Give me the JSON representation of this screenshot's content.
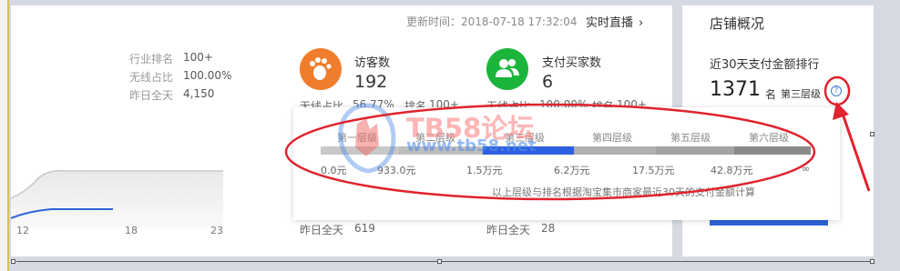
{
  "header": {
    "update_time": "更新时间：2018-07-18 17:32:04",
    "live_link": "实时直播",
    "live_chevron": "›"
  },
  "left_stats": [
    {
      "label": "行业排名",
      "value": "100+"
    },
    {
      "label": "无线占比",
      "value": "100.00%"
    },
    {
      "label": "昨日全天",
      "value": "4,150"
    }
  ],
  "visitors": {
    "title": "访客数",
    "value": "192",
    "wireless_label": "无线占比",
    "wireless_value": "56.77%",
    "rank_label": "排名",
    "rank_value": "100+",
    "yesterday_label": "昨日全天",
    "yesterday_value": "619",
    "icon": "footprint-icon",
    "color": "#f07d2b"
  },
  "buyers": {
    "title": "支付买家数",
    "value": "6",
    "wireless_label": "无线占比",
    "wireless_value": "100.00%",
    "rank_label": "排名",
    "rank_value": "100+",
    "yesterday_label": "昨日全天",
    "yesterday_value": "28",
    "icon": "users-icon",
    "color": "#1bb53c"
  },
  "chart": {
    "x_ticks": [
      "12",
      "18",
      "23"
    ]
  },
  "store": {
    "title": "店铺概况",
    "subtitle": "近30天支付金额排行",
    "rank": "1371",
    "rank_unit": "名",
    "tier": "第三层级"
  },
  "tooltip": {
    "tiers": [
      {
        "label": "第一层级",
        "value": "0.0元",
        "color": "#c8c8c8"
      },
      {
        "label": "第二层级",
        "value": "933.0元",
        "color": "#bdbdbd"
      },
      {
        "label": "第三层级",
        "value": "1.5万元",
        "color": "#2d5fe0"
      },
      {
        "label": "第四层级",
        "value": "6.2万元",
        "color": "#b0b0b0"
      },
      {
        "label": "第五层级",
        "value": "17.5万元",
        "color": "#a4a4a4"
      },
      {
        "label": "第六层级",
        "value": "42.8万元",
        "color": "#8a8a8a"
      }
    ],
    "end_value": "∞",
    "note": "以上层级与排名根据淘宝集市商家最近30天的支付金额计算"
  },
  "watermark": {
    "text": "TB58论坛",
    "url": "www.tb58.net"
  },
  "colors": {
    "accent": "#2d64d8",
    "annotation_red": "#e0232e"
  }
}
